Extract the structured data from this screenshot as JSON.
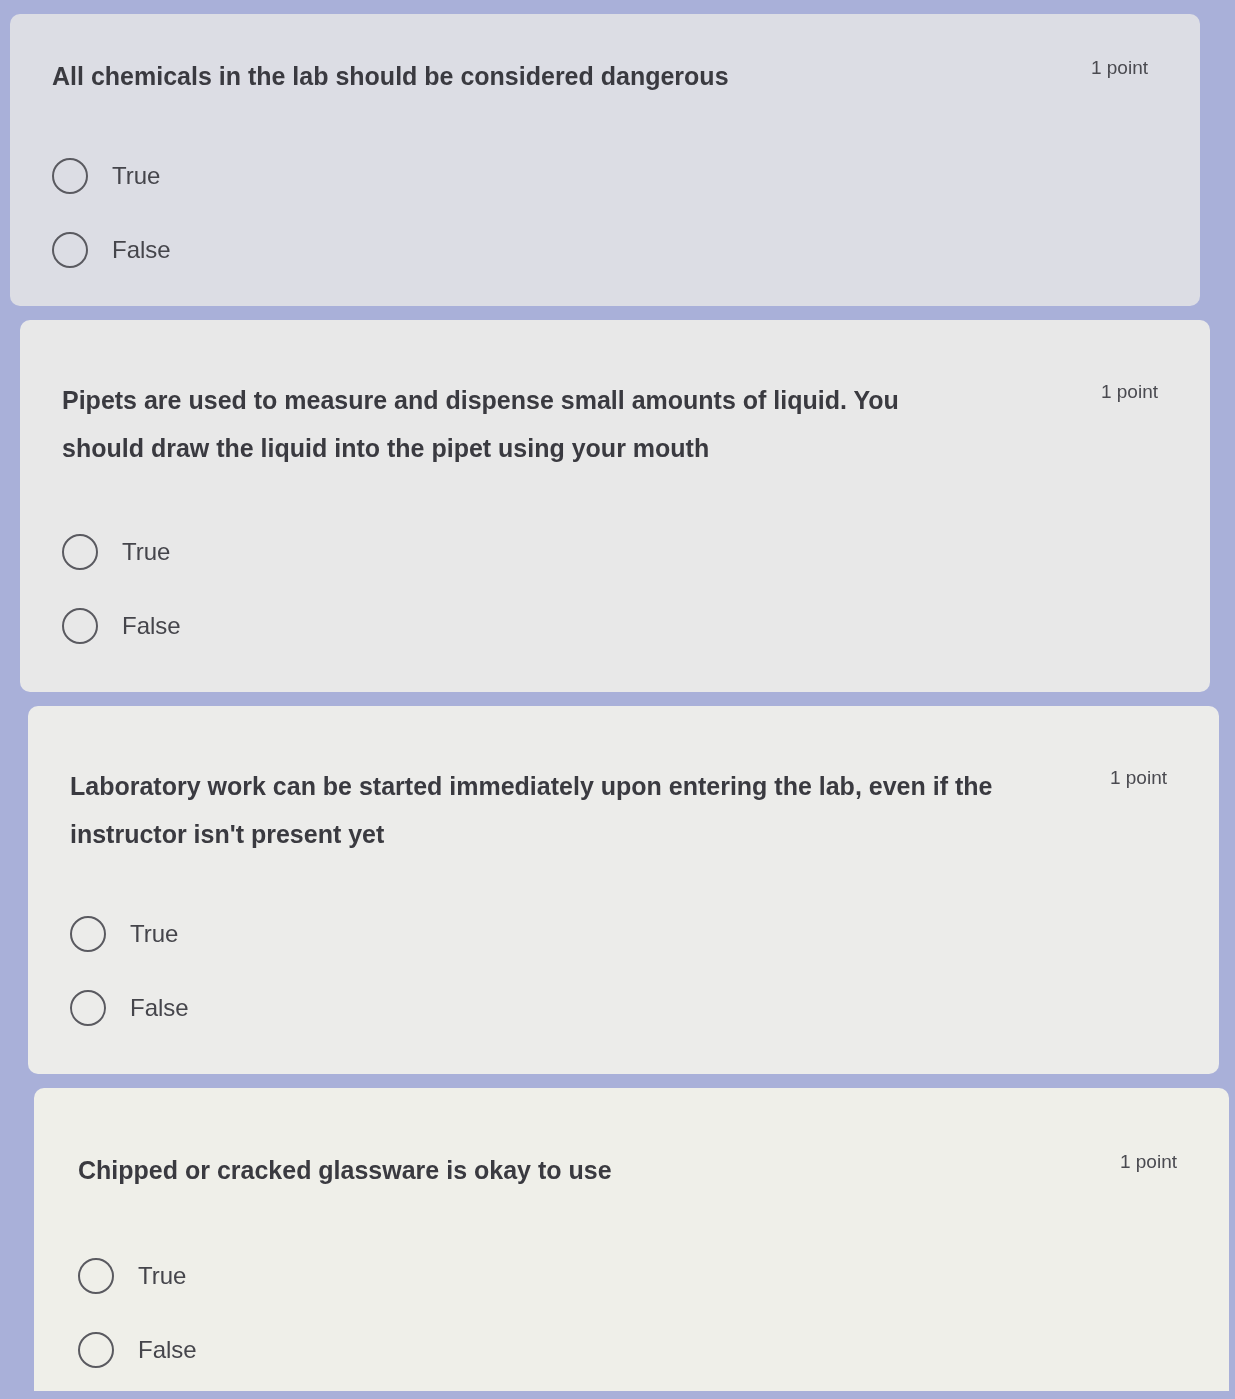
{
  "questions": [
    {
      "text": "All chemicals in the lab should be considered dangerous",
      "points": "1 point",
      "options": [
        {
          "label": "True",
          "selected": false
        },
        {
          "label": "False",
          "selected": false
        }
      ]
    },
    {
      "text": "Pipets are used to measure and dispense small amounts of liquid. You should draw the liquid into the pipet using your mouth",
      "points": "1 point",
      "options": [
        {
          "label": "True",
          "selected": false
        },
        {
          "label": "False",
          "selected": false
        }
      ]
    },
    {
      "text": "Laboratory work can be started immediately upon entering the lab, even if the instructor isn't present yet",
      "points": "1 point",
      "options": [
        {
          "label": "True",
          "selected": false
        },
        {
          "label": "False",
          "selected": false
        }
      ]
    },
    {
      "text": "Chipped or cracked glassware is okay to use",
      "points": "1 point",
      "options": [
        {
          "label": "True",
          "selected": false
        },
        {
          "label": "False",
          "selected": false
        }
      ]
    }
  ]
}
